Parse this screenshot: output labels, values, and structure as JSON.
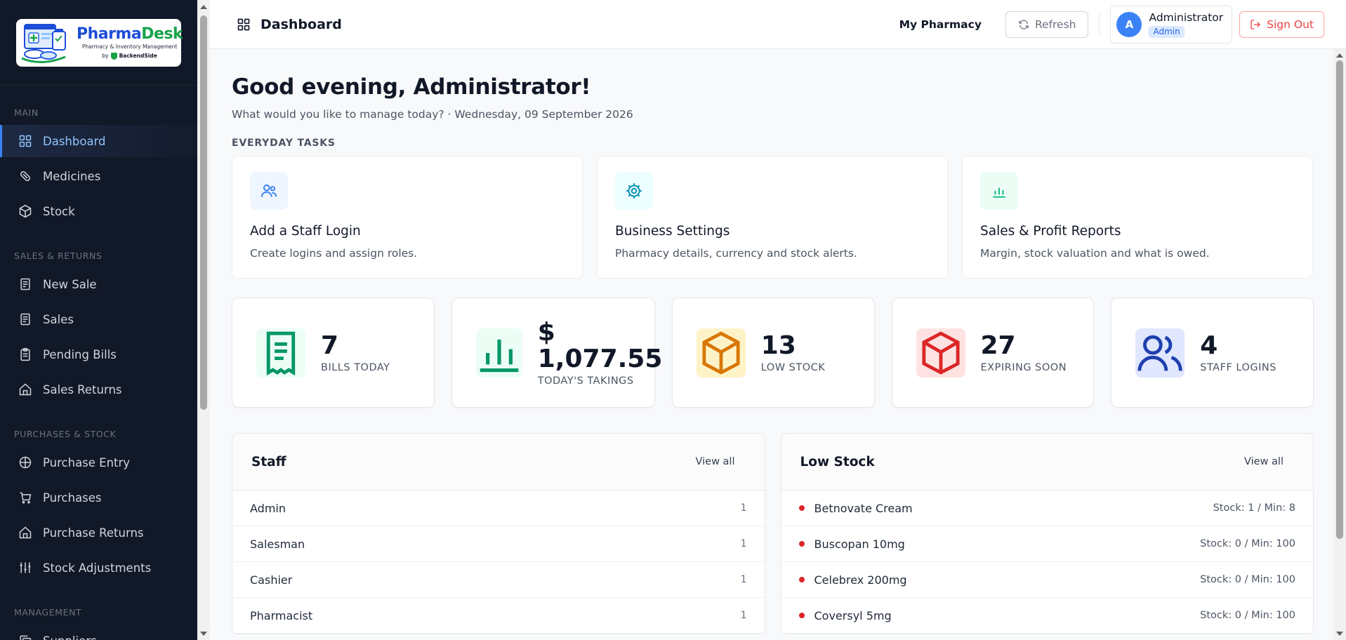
{
  "brand": {
    "name_part1": "Pharma",
    "name_part2": "Desk",
    "tagline": "Pharmacy & Inventory Management",
    "by": "by",
    "company": "BackendSide"
  },
  "sidebar": {
    "sections": [
      {
        "label": "MAIN",
        "items": [
          {
            "label": "Dashboard",
            "icon": "grid-icon",
            "active": true
          },
          {
            "label": "Medicines",
            "icon": "pill-icon"
          },
          {
            "label": "Stock",
            "icon": "cube-icon"
          }
        ]
      },
      {
        "label": "SALES & RETURNS",
        "items": [
          {
            "label": "New Sale",
            "icon": "receipt-icon"
          },
          {
            "label": "Sales",
            "icon": "receipt-icon"
          },
          {
            "label": "Pending Bills",
            "icon": "clipboard-icon"
          },
          {
            "label": "Sales Returns",
            "icon": "home-icon"
          }
        ]
      },
      {
        "label": "PURCHASES & STOCK",
        "items": [
          {
            "label": "Purchase Entry",
            "icon": "globe-icon"
          },
          {
            "label": "Purchases",
            "icon": "cart-icon"
          },
          {
            "label": "Purchase Returns",
            "icon": "home-icon"
          },
          {
            "label": "Stock Adjustments",
            "icon": "sliders-icon"
          }
        ]
      },
      {
        "label": "MANAGEMENT",
        "items": [
          {
            "label": "Suppliers",
            "icon": "copy-icon"
          }
        ]
      }
    ]
  },
  "header": {
    "title": "Dashboard",
    "pharmacy": "My Pharmacy",
    "refresh_label": "Refresh",
    "user_initial": "A",
    "user_name": "Administrator",
    "user_role": "Admin",
    "signout_label": "Sign Out"
  },
  "main": {
    "greeting": "Good evening, Administrator!",
    "subtitle": "What would you like to manage today? · Wednesday, 09 September 2026",
    "tasks_label": "EVERYDAY TASKS",
    "tasks": [
      {
        "title": "Add a Staff Login",
        "desc": "Create logins and assign roles.",
        "icon": "users-icon"
      },
      {
        "title": "Business Settings",
        "desc": "Pharmacy details, currency and stock alerts.",
        "icon": "gear-icon"
      },
      {
        "title": "Sales & Profit Reports",
        "desc": "Margin, stock valuation and what is owed.",
        "icon": "bar-chart-icon"
      }
    ],
    "stats": [
      {
        "value": "7",
        "label": "BILLS TODAY",
        "icon": "receipt-icon"
      },
      {
        "value_line1": "$",
        "value_line2": "1,077.55",
        "label": "TODAY'S TAKINGS",
        "icon": "bar-chart-icon"
      },
      {
        "value": "13",
        "label": "LOW STOCK",
        "icon": "box-icon"
      },
      {
        "value": "27",
        "label": "EXPIRING SOON",
        "icon": "box-icon"
      },
      {
        "value": "4",
        "label": "STAFF LOGINS",
        "icon": "users-icon"
      }
    ],
    "staff_panel": {
      "title": "Staff",
      "view_all": "View all",
      "rows": [
        {
          "name": "Admin",
          "count": "1"
        },
        {
          "name": "Salesman",
          "count": "1"
        },
        {
          "name": "Cashier",
          "count": "1"
        },
        {
          "name": "Pharmacist",
          "count": "1"
        }
      ]
    },
    "low_stock_panel": {
      "title": "Low Stock",
      "view_all": "View all",
      "rows": [
        {
          "name": "Betnovate Cream",
          "meta": "Stock: 1 / Min: 8"
        },
        {
          "name": "Buscopan 10mg",
          "meta": "Stock: 0 / Min: 100"
        },
        {
          "name": "Celebrex 200mg",
          "meta": "Stock: 0 / Min: 100"
        },
        {
          "name": "Coversyl 5mg",
          "meta": "Stock: 0 / Min: 100"
        }
      ]
    }
  },
  "colors": {
    "sidebar_bg": "#111827",
    "accent": "#3b82f6",
    "danger": "#ef4444",
    "green": "#059669",
    "amber": "#d97706",
    "red": "#dc2626",
    "indigo": "#1e40af"
  }
}
